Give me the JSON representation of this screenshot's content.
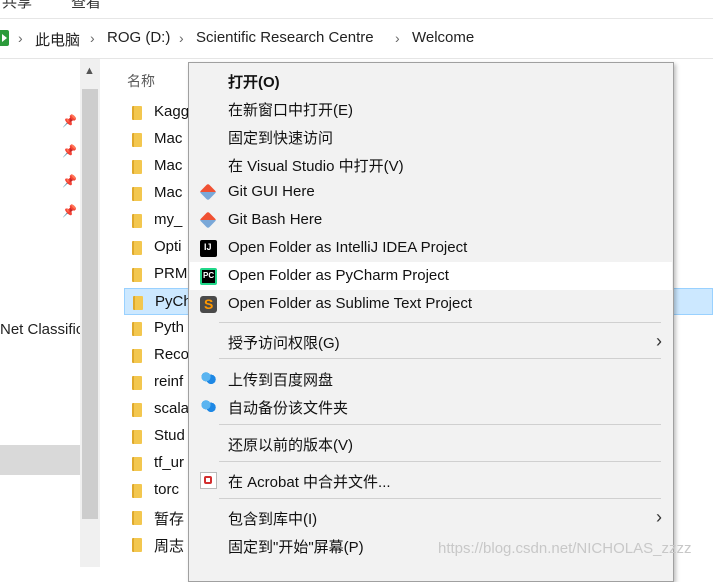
{
  "ribbon": {
    "tabs": [
      "共享",
      "查看"
    ]
  },
  "address_bar": {
    "breadcrumbs": [
      "此电脑",
      "ROG (D:)",
      "Scientific Research Centre",
      "Welcome"
    ]
  },
  "nav_pane": {
    "truncated_label": "Net Classific"
  },
  "file_list": {
    "column_header": "名称",
    "rows": [
      {
        "name": "Kagg"
      },
      {
        "name": "Mac"
      },
      {
        "name": "Mac"
      },
      {
        "name": "Mac"
      },
      {
        "name": "my_"
      },
      {
        "name": "Opti"
      },
      {
        "name": "PRM"
      },
      {
        "name": "PyCh"
      },
      {
        "name": "Pyth"
      },
      {
        "name": "Reco"
      },
      {
        "name": "reinf"
      },
      {
        "name": "scala"
      },
      {
        "name": "Stud"
      },
      {
        "name": "tf_ur"
      },
      {
        "name": "torc"
      },
      {
        "name": "暂存"
      },
      {
        "name": "周志"
      }
    ],
    "selected_row": "PyCh"
  },
  "context_menu": {
    "items": [
      {
        "label": "打开(O)",
        "icon": "",
        "bold": true
      },
      {
        "label": "在新窗口中打开(E)",
        "icon": ""
      },
      {
        "label": "固定到快速访问",
        "icon": ""
      },
      {
        "label": "在 Visual Studio 中打开(V)",
        "icon": ""
      },
      {
        "label": "Git GUI Here",
        "icon": "git-icon"
      },
      {
        "label": "Git Bash Here",
        "icon": "git-icon"
      },
      {
        "label": "Open Folder as IntelliJ IDEA Project",
        "icon": "intellij-icon"
      },
      {
        "label": "Open Folder as PyCharm Project",
        "icon": "pycharm-icon",
        "hovered": true
      },
      {
        "label": "Open Folder as Sublime Text Project",
        "icon": "sublime-icon"
      },
      {
        "label": "授予访问权限(G)",
        "icon": "",
        "submenu": true
      },
      {
        "label": "上传到百度网盘",
        "icon": "baidu-netdisk-icon"
      },
      {
        "label": "自动备份该文件夹",
        "icon": "baidu-netdisk-icon"
      },
      {
        "label": "还原以前的版本(V)",
        "icon": ""
      },
      {
        "label": "在 Acrobat 中合并文件...",
        "icon": "acrobat-icon"
      },
      {
        "label": "包含到库中(I)",
        "icon": "",
        "submenu": true
      },
      {
        "label": "固定到\"开始\"屏幕(P)",
        "icon": ""
      }
    ]
  },
  "watermark": "https://blog.csdn.net/NICHOLAS_zzzz"
}
